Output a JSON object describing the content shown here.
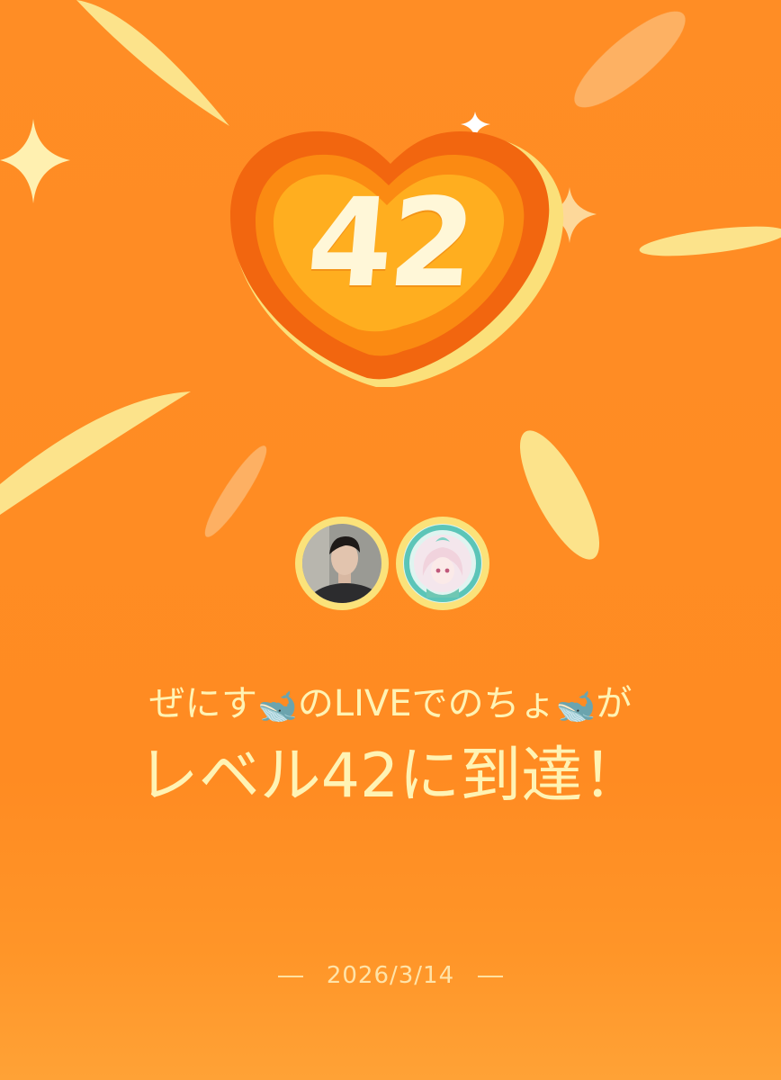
{
  "badge": {
    "level": "42",
    "icon": "heart-icon"
  },
  "avatars": {
    "streamer": {
      "icon": "user-photo-avatar"
    },
    "viewer": {
      "icon": "anime-character-avatar"
    }
  },
  "message": {
    "streamer_name": "ぜにす",
    "connector": "のLIVEで",
    "viewer_name": "のちょ",
    "suffix": "が",
    "name_emoji": "🐋",
    "headline": "レベル42に到達！"
  },
  "date": "2026/3/14",
  "colors": {
    "background": "#ff8b22",
    "text": "#fff3b4",
    "accent": "#fbe27a"
  }
}
